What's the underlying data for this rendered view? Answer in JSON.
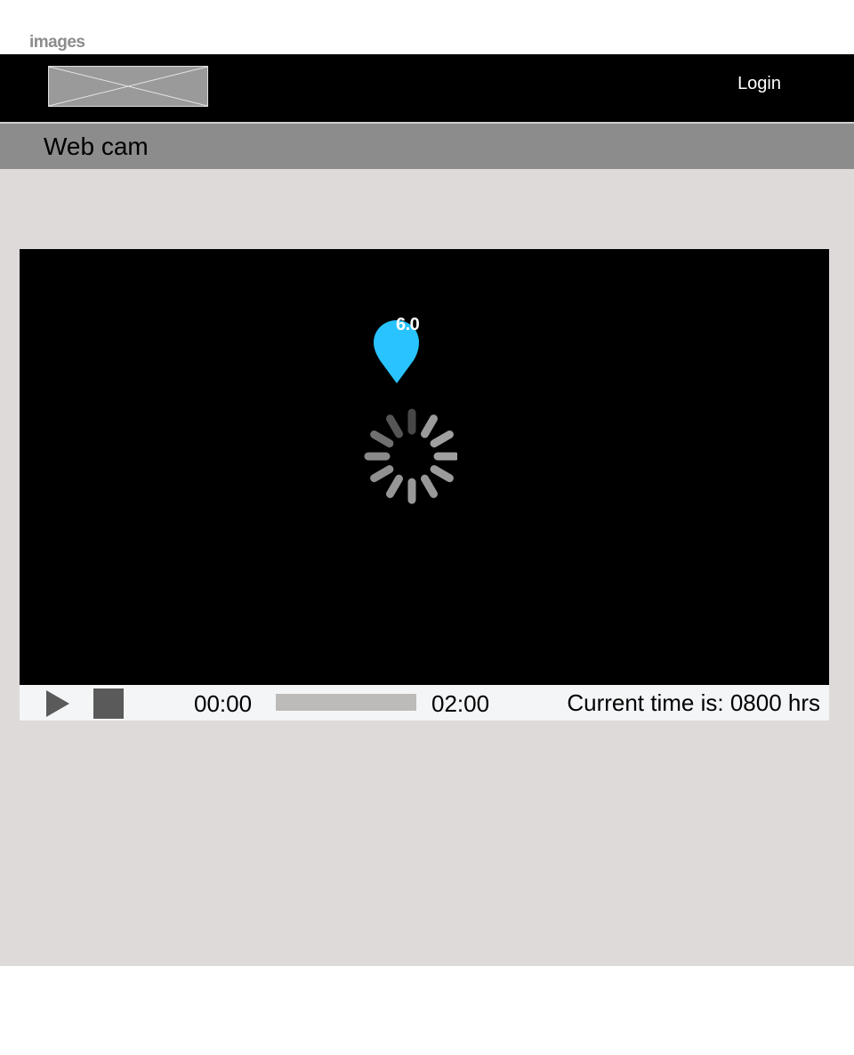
{
  "top_label": "images",
  "header": {
    "logo_icon": "image-placeholder-icon",
    "login_label": "Login"
  },
  "title_bar": {
    "title": "Web cam"
  },
  "video": {
    "marker_icon": "map-pin-icon",
    "marker_value": "6.0",
    "marker_color": "#29c3ff",
    "spinner_icon": "loading-spinner-icon"
  },
  "controls": {
    "play_icon": "play-icon",
    "stop_icon": "stop-icon",
    "start_time": "00:00",
    "end_time": "02:00",
    "progress_fraction": 0,
    "current_time_text": "Current time is: 0800 hrs"
  }
}
